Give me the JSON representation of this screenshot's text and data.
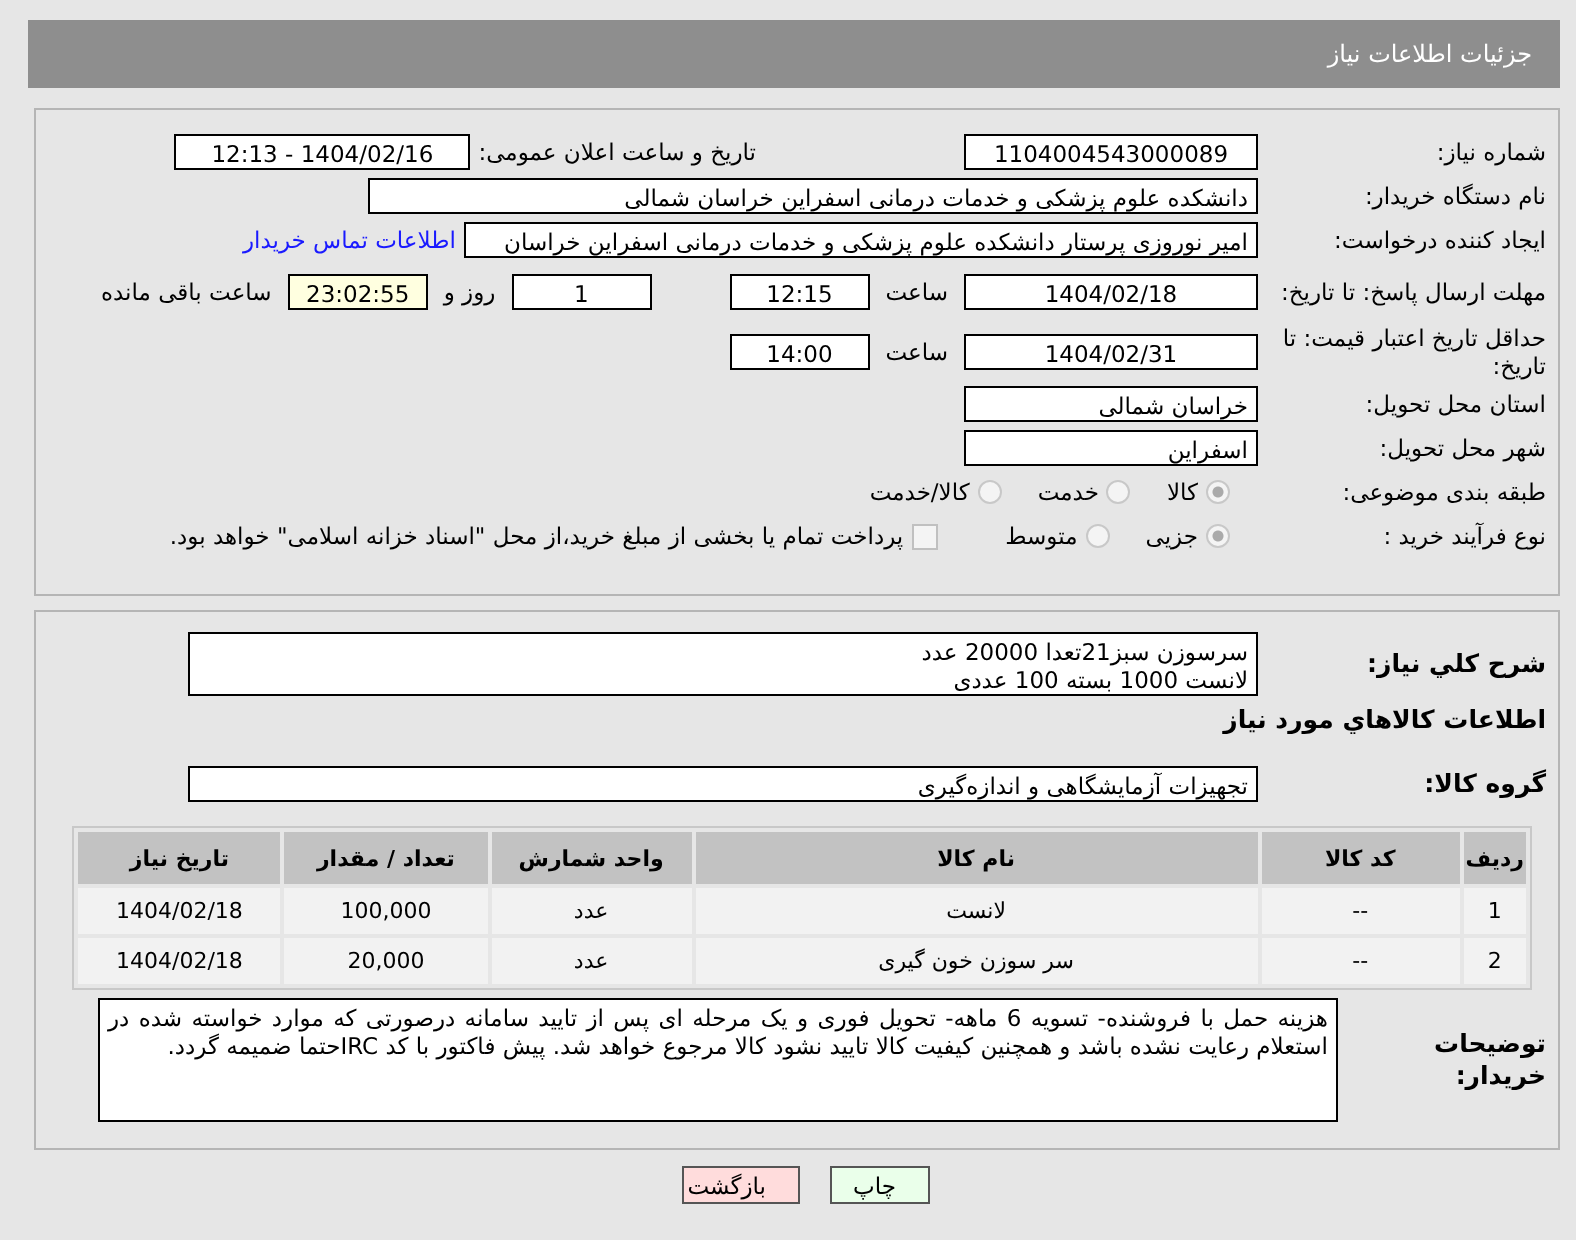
{
  "header": {
    "title": "جزئیات اطلاعات نیاز"
  },
  "fields": {
    "need_number": {
      "label": "شماره نیاز:",
      "value": "1104004543000089"
    },
    "announce": {
      "label": "تاریخ و ساعت اعلان عمومی:",
      "value": "1404/02/16 - 12:13"
    },
    "buyer": {
      "label": "نام دستگاه خریدار:",
      "value": "دانشکده علوم پزشکی و خدمات درمانی اسفراین خراسان شمالی"
    },
    "creator": {
      "label": "ایجاد کننده درخواست:",
      "value": "امیر  نوروزی  پرستار  دانشکده علوم پزشکی و خدمات درمانی اسفراین خراسان",
      "link": "اطلاعات تماس خریدار"
    },
    "deadline": {
      "label": "مهلت ارسال پاسخ: تا تاریخ:",
      "date": "1404/02/18",
      "time_label": "ساعت",
      "time": "12:15",
      "days": "1",
      "days_label": "روز و",
      "remaining": "23:02:55",
      "remaining_label": "ساعت باقی مانده"
    },
    "validity": {
      "label": "حداقل تاریخ اعتبار قیمت: تا تاریخ:",
      "date": "1404/02/31",
      "time_label": "ساعت",
      "time": "14:00"
    },
    "province": {
      "label": "استان محل تحویل:",
      "value": "خراسان شمالی"
    },
    "city": {
      "label": "شهر محل تحویل:",
      "value": "اسفراین"
    },
    "category": {
      "label": "طبقه بندی موضوعی:",
      "options": [
        {
          "label": "کالا",
          "selected": true
        },
        {
          "label": "خدمت",
          "selected": false
        },
        {
          "label": "کالا/خدمت",
          "selected": false
        }
      ]
    },
    "process": {
      "label": "نوع فرآیند خرید :",
      "options": [
        {
          "label": "جزیی",
          "selected": true
        },
        {
          "label": "متوسط",
          "selected": false
        }
      ],
      "payment": {
        "label": "پرداخت تمام یا بخشی از مبلغ خرید،از محل \"اسناد خزانه اسلامی\" خواهد بود.",
        "checked": false
      }
    }
  },
  "summary": {
    "label": "شرح کلي نياز:",
    "lines": [
      "سرسوزن سبز21تعدا 20000 عدد",
      "لانست 1000 بسته 100 عددی"
    ]
  },
  "items_heading": "اطلاعات کالاهاي مورد نياز",
  "goods_group": {
    "label": "گروه کالا:",
    "value": "تجهیزات آزمایشگاهی و اندازه‌گیری"
  },
  "table": {
    "columns": [
      "ردیف",
      "کد کالا",
      "نام کالا",
      "واحد شمارش",
      "تعداد / مقدار",
      "تاریخ نیاز"
    ],
    "rows": [
      [
        "1",
        "--",
        "لانست",
        "عدد",
        "100,000",
        "1404/02/18"
      ],
      [
        "2",
        "--",
        "سر سوزن خون گیری",
        "عدد",
        "20,000",
        "1404/02/18"
      ]
    ]
  },
  "buyer_notes": {
    "label": "توضیحات خریدار:",
    "text": "هزینه حمل با فروشنده- تسویه 6 ماهه- تحویل فوری و یک مرحله ای پس از تایید سامانه درصورتی که موارد خواسته شده در استعلام رعایت نشده باشد و همچنین کیفیت کالا تایید نشود کالا مرجوع خواهد شد. پیش فاکتور با کد IRCحتما ضمیمه گردد."
  },
  "buttons": [
    {
      "label": "چاپ",
      "kind": "print"
    },
    {
      "label": "بازگشت",
      "kind": "back"
    }
  ]
}
